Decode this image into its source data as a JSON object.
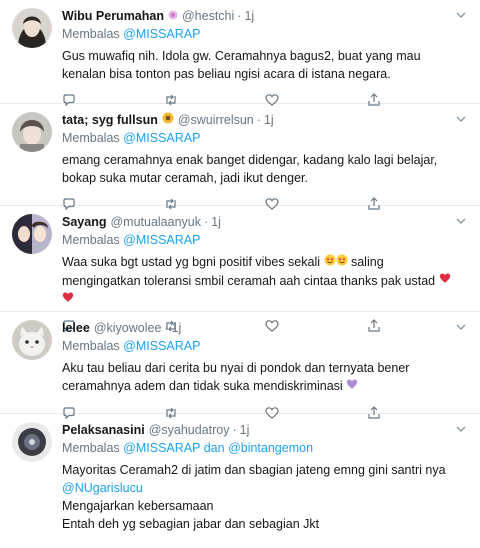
{
  "tweets": [
    {
      "name": "Wibu Perumahan",
      "handle": "@hestchi",
      "time": "1j",
      "reply_prefix": "Membalas",
      "reply_to": "@MISSARAP",
      "text": "Gus muwafiq nih. Idola gw. Ceramahnya bagus2, buat yang mau kenalan bisa tonton pas beliau ngisi acara di istana negara."
    },
    {
      "name": "tata; syg fullsun",
      "handle": "@swuirrelsun",
      "time": "1j",
      "reply_prefix": "Membalas",
      "reply_to": "@MISSARAP",
      "text": "emang ceramahnya enak banget didengar, kadang kalo lagi belajar, bokap suka mutar ceramah, jadi ikut denger."
    },
    {
      "name": "Sayang",
      "handle": "@mutualaanyuk",
      "time": "1j",
      "reply_prefix": "Membalas",
      "reply_to": "@MISSARAP",
      "text_a": "Waa suka bgt ustad yg bgni positif vibes sekali",
      "text_b": "saling mengingatkan toleransi smbil ceramah aah cintaa thanks pak ustad"
    },
    {
      "name": "lelee",
      "handle": "@kiyowolee",
      "time": "1j",
      "reply_prefix": "Membalas",
      "reply_to": "@MISSARAP",
      "text": "Aku tau beliau dari cerita bu nyai di pondok dan ternyata bener ceramahnya adem dan tidak suka mendiskriminasi"
    },
    {
      "name": "Pelaksanasini",
      "handle": "@syahudatroy",
      "time": "1j",
      "reply_prefix": "Membalas",
      "reply_to": "@MISSARAP",
      "reply_and": "dan",
      "reply_to_2": "@bintangemon",
      "text_line1": "Mayoritas Ceramah2 di jatim dan sbagian jateng emng gini santri nya",
      "text_mention": "@NUgarislucu",
      "text_line2": "Mengajarkan kebersamaan",
      "text_line3": "Entah deh yg sebagian jabar dan sebagian Jkt"
    }
  ],
  "icons": [
    "reply-icon",
    "retweet-icon",
    "like-icon",
    "share-icon",
    "caret-down-icon"
  ],
  "colors": {
    "accent": "#1da1f2",
    "muted": "#657786",
    "text": "#14171a",
    "border": "#e6ecf0"
  }
}
